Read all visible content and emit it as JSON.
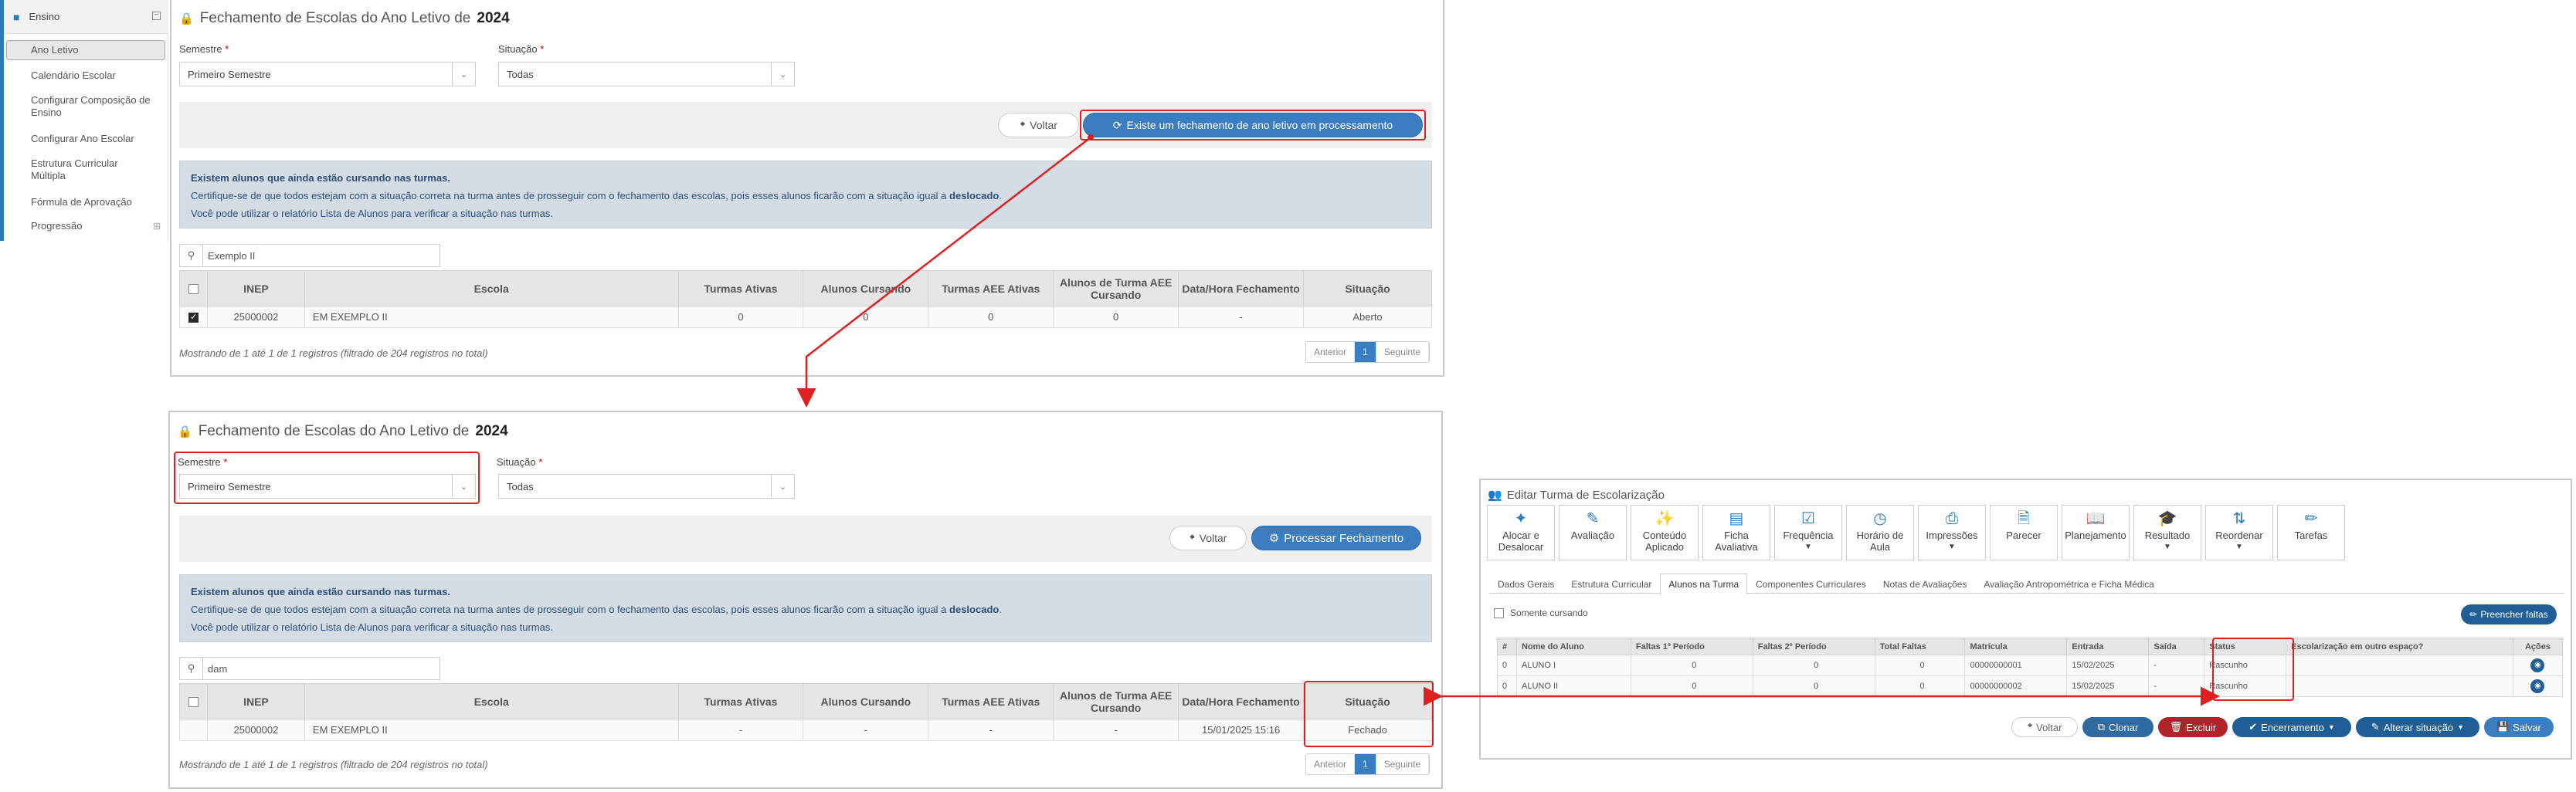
{
  "sidebar": {
    "header": "Ensino",
    "items": [
      "Ano Letivo",
      "Calendário Escolar",
      "Configurar Composição de Ensino",
      "Configurar Ano Escolar",
      "Estrutura Curricular Múltipla",
      "Fórmula de Aprovação",
      "Progressão"
    ]
  },
  "top_panel": {
    "title_prefix": "Fechamento de Escolas do Ano Letivo de",
    "year": "2024",
    "semestre_label": "Semestre",
    "semestre_value": "Primeiro Semestre",
    "situacao_label": "Situação",
    "situacao_value": "Todas",
    "back_label": "Voltar",
    "action_label": "Existe um fechamento de ano letivo em processamento",
    "alert_title": "Existem alunos que ainda estão cursando nas turmas.",
    "alert_line2_a": "Certifique-se de que todos estejam com a situação correta na turma antes de prosseguir com o fechamento das escolas, pois esses alunos ficarão com a situação igual a ",
    "alert_line2_b": "deslocado",
    "alert_line3": "Você pode utilizar o relatório Lista de Alunos para verificar a situação nas turmas.",
    "search_value": "Exemplo II",
    "columns": [
      "INEP",
      "Escola",
      "Turmas Ativas",
      "Alunos Cursando",
      "Turmas AEE Ativas",
      "Alunos de Turma AEE Cursando",
      "Data/Hora Fechamento",
      "Situação"
    ],
    "row": [
      "25000002",
      "EM EXEMPLO II",
      "0",
      "0",
      "0",
      "0",
      "-",
      "Aberto"
    ],
    "info": "Mostrando de 1 até 1 de 1 registros (filtrado de 204 registros no total)",
    "pager": [
      "Anterior",
      "1",
      "Seguinte"
    ]
  },
  "bottom_panel": {
    "title_prefix": "Fechamento de Escolas do Ano Letivo de",
    "year": "2024",
    "semestre_label": "Semestre",
    "semestre_value": "Primeiro Semestre",
    "situacao_label": "Situação",
    "situacao_value": "Todas",
    "back_label": "Voltar",
    "action_label": "Processar Fechamento",
    "alert_title": "Existem alunos que ainda estão cursando nas turmas.",
    "alert_line2_a": "Certifique-se de que todos estejam com a situação correta na turma antes de prosseguir com o fechamento das escolas, pois esses alunos ficarão com a situação igual a ",
    "alert_line2_b": "deslocado",
    "alert_line3": "Você pode utilizar o relatório Lista de Alunos para verificar a situação nas turmas.",
    "search_value": "dam",
    "columns": [
      "INEP",
      "Escola",
      "Turmas Ativas",
      "Alunos Cursando",
      "Turmas AEE Ativas",
      "Alunos de Turma AEE Cursando",
      "Data/Hora Fechamento",
      "Situação"
    ],
    "row": [
      "25000002",
      "EM EXEMPLO II",
      "-",
      "-",
      "-",
      "-",
      "15/01/2025 15:16",
      "Fechado"
    ],
    "info": "Mostrando de 1 até 1 de 1 registros (filtrado de 204 registros no total)",
    "pager": [
      "Anterior",
      "1",
      "Seguinte"
    ]
  },
  "right_panel": {
    "title": "Editar Turma de Escolarização",
    "toolbar": [
      "Alocar e Desalocar",
      "Avaliação",
      "Conteúdo Aplicado",
      "Ficha Avaliativa",
      "Frequência",
      "Horário de Aula",
      "Impressões",
      "Parecer",
      "Planejamento",
      "Resultado",
      "Reordenar",
      "Tarefas"
    ],
    "tabs": [
      "Dados Gerais",
      "Estrutura Curricular",
      "Alunos na Turma",
      "Componentes Curriculares",
      "Notas de Avaliações",
      "Avaliação Antropométrica e Ficha Médica"
    ],
    "somente_cursando": "Somente cursando",
    "preencher_faltas": "Preencher faltas",
    "columns": [
      "#",
      "Nome do Aluno",
      "Faltas 1º Período",
      "Faltas 2º Período",
      "Total Faltas",
      "Matrícula",
      "Entrada",
      "Saída",
      "Status",
      "Escolarização em outro espaço?",
      "Ações"
    ],
    "rows": [
      [
        "0",
        "ALUNO I",
        "0",
        "0",
        "0",
        "00000000001",
        "15/02/2025",
        "-",
        "Rascunho",
        "",
        ""
      ],
      [
        "0",
        "ALUNO II",
        "0",
        "0",
        "0",
        "00000000002",
        "15/02/2025",
        "-",
        "Rascunho",
        "",
        ""
      ]
    ],
    "buttons": {
      "voltar": "Voltar",
      "clonar": "Clonar",
      "excluir": "Excluir",
      "encerramento": "Encerramento",
      "alterar": "Alterar situação",
      "salvar": "Salvar"
    }
  },
  "colors": {
    "primary": "#3a7dc1",
    "danger": "#c0392b",
    "highlight": "#e02020",
    "alert_bg": "#d4dce6",
    "dark_blue": "#1f5f95"
  }
}
